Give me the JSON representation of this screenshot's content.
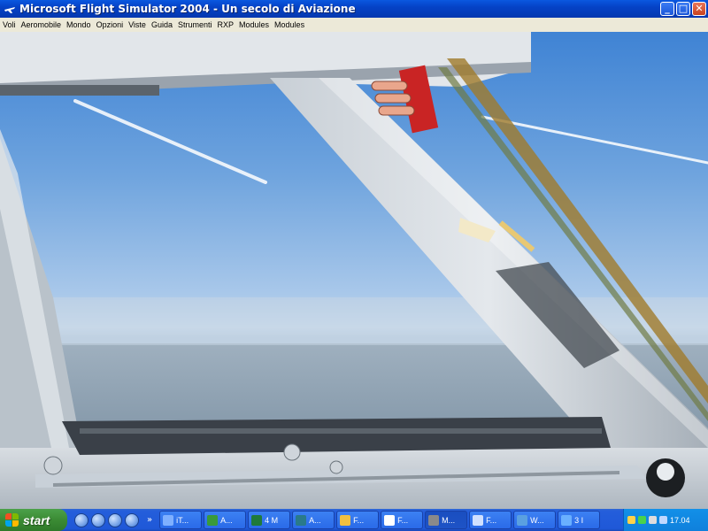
{
  "window": {
    "title": "Microsoft Flight Simulator 2004 - Un secolo di Aviazione",
    "buttons": {
      "minimize": "_",
      "maximize": "□",
      "close": "✕"
    }
  },
  "menu": {
    "items": [
      "Voli",
      "Aeromobile",
      "Mondo",
      "Opzioni",
      "Viste",
      "Guida",
      "Strumenti",
      "RXP",
      "Modules",
      "Modules"
    ]
  },
  "taskbar": {
    "start_label": "start",
    "quick_launch_chevron": "»",
    "tasks": [
      {
        "label": "iT...",
        "color": "#7fb0ff"
      },
      {
        "label": "A...",
        "color": "#3a9a3a"
      },
      {
        "label": "4 M",
        "color": "#1f7a3a"
      },
      {
        "label": "A...",
        "color": "#2a7a8a"
      },
      {
        "label": "F...",
        "color": "#f0c040"
      },
      {
        "label": "F...",
        "color": "#ffffff"
      },
      {
        "label": "M...",
        "color": "#8a8a8a"
      },
      {
        "label": "F...",
        "color": "#d0e0ff"
      },
      {
        "label": "W...",
        "color": "#5aa0e0"
      },
      {
        "label": "3 I",
        "color": "#6ab0ff"
      }
    ],
    "clock": "17.04"
  },
  "icons": {
    "app": "flight-simulator-icon",
    "start": "windows-flag-icon"
  }
}
